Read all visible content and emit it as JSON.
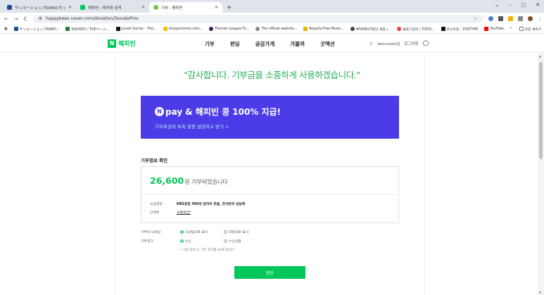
{
  "browser": {
    "tabs": [
      {
        "title": "サッカーショップKAMO/サッカーユニ",
        "active": false,
        "fav_color": "#1d4e9e"
      },
      {
        "title": "해피빈 : 테마와 검색",
        "active": false,
        "fav_color": "#03c75a"
      },
      {
        "title": "기부 : 해피빈",
        "active": true,
        "fav_color": "#7ac04b"
      }
    ],
    "new_tab": "+",
    "window_controls": [
      "⌄",
      "–",
      "▢",
      "✕"
    ],
    "nav": {
      "back": "←",
      "forward": "→",
      "reload": "C"
    },
    "url": "happybean.naver.com/donation/DonateProc",
    "bookmarks": [
      {
        "label": "サッカーショップKAMO...",
        "color": "#1d4e9e"
      },
      {
        "label": "KISHSPO / TOPページ...",
        "color": "#2e7d32"
      },
      {
        "label": "Lovell Soccer – Foo...",
        "color": "#111"
      },
      {
        "label": "Unisportstore.com...",
        "color": "#f5c400"
      },
      {
        "label": "Premier League Fo...",
        "color": "#3d195b"
      },
      {
        "label": "The official website...",
        "color": "#888"
      },
      {
        "label": "Royalty-Free Music...",
        "color": "#f0b400"
      },
      {
        "label": "#583827822 계정 |...",
        "color": "#444"
      },
      {
        "label": "블로그관리 | TISTO...",
        "color": "#ea4335"
      },
      {
        "label": "포스타입 – POSTYPE",
        "color": "#111"
      },
      {
        "label": "YouTube",
        "color": "#ff0000"
      }
    ],
    "bookmarks_more": "»",
    "all_bookmarks": "모든 북마크"
  },
  "site": {
    "logo_mark": "N",
    "logo_text": "해피빈",
    "nav": [
      "기부",
      "펀딩",
      "공감가게",
      "가볼까",
      "굿액션"
    ],
    "user": "lamcnoon님",
    "logout": "로그아웃"
  },
  "main": {
    "thanks": "\"감사합니다. 기부금을 소중하게 사용하겠습니다.\"",
    "banner": {
      "pay_logo": "pay",
      "headline": "& 해피빈 콩 100% 지급!",
      "sub": "기부톡공대 톡톡 알림 설정하고 받기 >"
    },
    "section_title": "기부정보 확인",
    "amount": "26,600",
    "amount_msg": "원 기부되었습니다",
    "campaign_label": "모금함명",
    "campaign_value": "KBS충청 496회 엄마의 뜻을, 한국반학 상남래",
    "org_label": "단체명",
    "org_value": "소목유산*",
    "options": [
      {
        "label": "기부자 닉네임",
        "choices": [
          "닉네임으로 표시",
          "익명으로 표시"
        ],
        "selected": 0
      },
      {
        "label": "기부후기",
        "choices": [
          "수신",
          "수신안함"
        ],
        "selected": 0
      }
    ],
    "note": "• 사업 종료 후, 기부 후기를 보내드립니다",
    "confirm": "확인"
  },
  "colors": {
    "brand_green": "#03c75a",
    "banner_bg": "#4b3ce8",
    "thanks_green": "#1fb34f"
  }
}
